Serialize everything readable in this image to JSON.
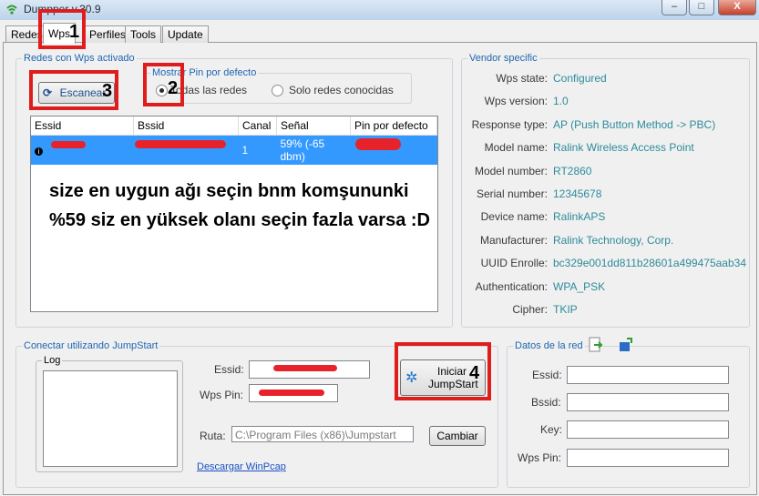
{
  "window": {
    "title": "Dumpper v.30.9",
    "minimize": "–",
    "maximize": "□",
    "close": "X"
  },
  "tabs": [
    {
      "label": "Redes"
    },
    {
      "label": "Wps"
    },
    {
      "label": "Perfiles"
    },
    {
      "label": "Tools"
    },
    {
      "label": "Update"
    }
  ],
  "wps_group": {
    "legend": "Redes con Wps activado",
    "scan_button": "Escanear",
    "pin_group": {
      "legend": "Mostrar Pin por defecto",
      "option_all": "Todas las redes",
      "option_known": "Solo redes conocidas"
    },
    "table": {
      "headers": [
        "Essid",
        "Bssid",
        "Canal",
        "Señal",
        "Pin por defecto"
      ],
      "row": {
        "canal": "1",
        "senal": "59% (-65 dbm)"
      }
    },
    "annotation_text": "size en uygun ağı seçin bnm komşununki %59 siz en yüksek olanı seçin fazla varsa :D"
  },
  "vendor": {
    "legend": "Vendor specific",
    "fields": [
      {
        "label": "Wps state:",
        "value": "Configured"
      },
      {
        "label": "Wps version:",
        "value": "1.0"
      },
      {
        "label": "Response type:",
        "value": "AP (Push Button Method -> PBC)"
      },
      {
        "label": "Model name:",
        "value": "Ralink Wireless Access Point"
      },
      {
        "label": "Model number:",
        "value": "RT2860"
      },
      {
        "label": "Serial number:",
        "value": "12345678"
      },
      {
        "label": "Device name:",
        "value": "RalinkAPS"
      },
      {
        "label": "Manufacturer:",
        "value": "Ralink Technology, Corp."
      },
      {
        "label": "UUID Enrolle:",
        "value": "bc329e001dd811b28601a499475aab34"
      },
      {
        "label": "Authentication:",
        "value": "WPA_PSK"
      },
      {
        "label": "Cipher:",
        "value": "TKIP"
      }
    ]
  },
  "jumpstart": {
    "legend": "Conectar utilizando JumpStart",
    "log_legend": "Log",
    "essid_label": "Essid:",
    "wpspin_label": "Wps Pin:",
    "start_button_line1": "Iniciar",
    "start_button_line2": "JumpStart",
    "ruta_label": "Ruta:",
    "ruta_value": "C:\\Program Files (x86)\\Jumpstart",
    "change_button": "Cambiar",
    "winpcap_link": "Descargar WinPcap"
  },
  "network_data": {
    "legend": "Datos de la red",
    "essid_label": "Essid:",
    "bssid_label": "Bssid:",
    "key_label": "Key:",
    "wpspin_label": "Wps Pin:"
  },
  "annotations": {
    "n1": "1",
    "n2": "2",
    "n3": "3",
    "n4": "4"
  },
  "colors": {
    "highlight": "#e01d1d",
    "selection": "#3399ff",
    "legend_blue": "#1e66b0",
    "value_teal": "#2e8b9b"
  }
}
